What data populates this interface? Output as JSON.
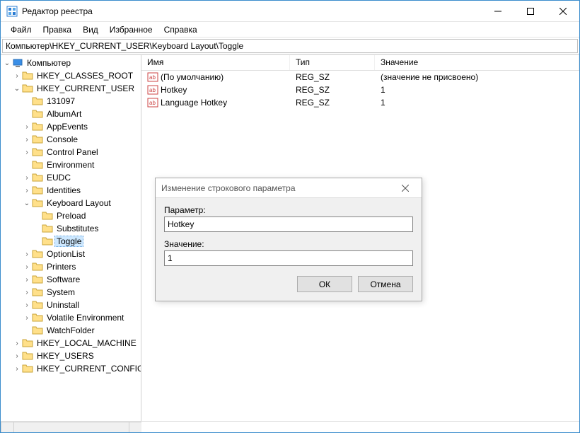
{
  "window": {
    "title": "Редактор реестра"
  },
  "menu": {
    "file": "Файл",
    "edit": "Правка",
    "view": "Вид",
    "favorites": "Избранное",
    "help": "Справка"
  },
  "address": "Компьютер\\HKEY_CURRENT_USER\\Keyboard Layout\\Toggle",
  "tree": {
    "root": "Компьютер",
    "hkcr": "HKEY_CLASSES_ROOT",
    "hkcu": "HKEY_CURRENT_USER",
    "hkcu_children": [
      "131097",
      "AlbumArt",
      "AppEvents",
      "Console",
      "Control Panel",
      "Environment",
      "EUDC",
      "Identities"
    ],
    "kb": "Keyboard Layout",
    "kb_children": [
      "Preload",
      "Substitutes",
      "Toggle"
    ],
    "hkcu_after": [
      "OptionList",
      "Printers",
      "Software",
      "System",
      "Uninstall",
      "Volatile Environment",
      "WatchFolder"
    ],
    "hklm": "HKEY_LOCAL_MACHINE",
    "hku": "HKEY_USERS",
    "hkcc": "HKEY_CURRENT_CONFIG"
  },
  "list": {
    "headers": {
      "name": "Имя",
      "type": "Тип",
      "value": "Значение"
    },
    "rows": [
      {
        "name": "(По умолчанию)",
        "type": "REG_SZ",
        "value": "(значение не присвоено)"
      },
      {
        "name": "Hotkey",
        "type": "REG_SZ",
        "value": "1"
      },
      {
        "name": "Language Hotkey",
        "type": "REG_SZ",
        "value": "1"
      }
    ]
  },
  "dialog": {
    "title": "Изменение строкового параметра",
    "param_label": "Параметр:",
    "param_value": "Hotkey",
    "value_label": "Значение:",
    "value_value": "1",
    "ok": "ОК",
    "cancel": "Отмена"
  }
}
